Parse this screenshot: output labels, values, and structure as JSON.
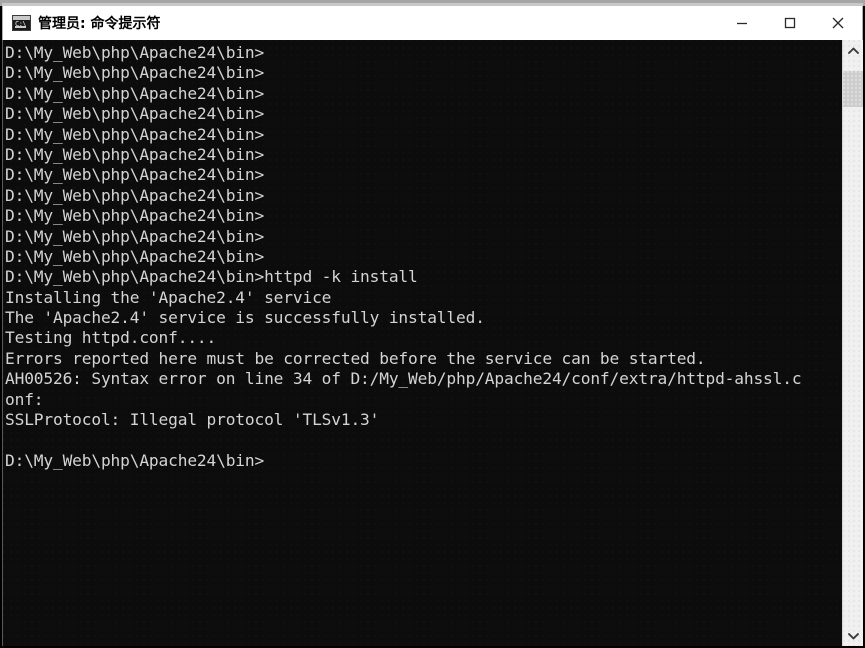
{
  "window": {
    "title": "管理员: 命令提示符",
    "icon": "cmd-console-icon",
    "icon_glyph": "C:\\",
    "controls": {
      "minimize": "minimize-icon",
      "maximize": "maximize-icon",
      "close": "close-icon"
    },
    "background_color": "#0c0c0c",
    "text_color": "#d4d4d4",
    "titlebar_color": "#ffffff"
  },
  "console": {
    "prompt": "D:\\My_Web\\php\\Apache24\\bin>",
    "lines": [
      "D:\\My_Web\\php\\Apache24\\bin>",
      "D:\\My_Web\\php\\Apache24\\bin>",
      "D:\\My_Web\\php\\Apache24\\bin>",
      "D:\\My_Web\\php\\Apache24\\bin>",
      "D:\\My_Web\\php\\Apache24\\bin>",
      "D:\\My_Web\\php\\Apache24\\bin>",
      "D:\\My_Web\\php\\Apache24\\bin>",
      "D:\\My_Web\\php\\Apache24\\bin>",
      "D:\\My_Web\\php\\Apache24\\bin>",
      "D:\\My_Web\\php\\Apache24\\bin>",
      "D:\\My_Web\\php\\Apache24\\bin>",
      "D:\\My_Web\\php\\Apache24\\bin>httpd -k install",
      "Installing the 'Apache2.4' service",
      "The 'Apache2.4' service is successfully installed.",
      "Testing httpd.conf....",
      "Errors reported here must be corrected before the service can be started.",
      "AH00526: Syntax error on line 34 of D:/My_Web/php/Apache24/conf/extra/httpd-ahssl.c",
      "onf:",
      "SSLProtocol: Illegal protocol 'TLSv1.3'",
      "",
      "D:\\My_Web\\php\\Apache24\\bin>"
    ],
    "command": "httpd -k install",
    "service_name": "Apache2.4",
    "error_code": "AH00526",
    "error_line_number": "34",
    "error_file": "D:/My_Web/php/Apache24/conf/extra/httpd-ahssl.conf",
    "error_detail": "SSLProtocol: Illegal protocol 'TLSv1.3'"
  },
  "scrollbar": {
    "up_arrow": "chevron-up-icon",
    "down_arrow": "chevron-down-icon"
  }
}
